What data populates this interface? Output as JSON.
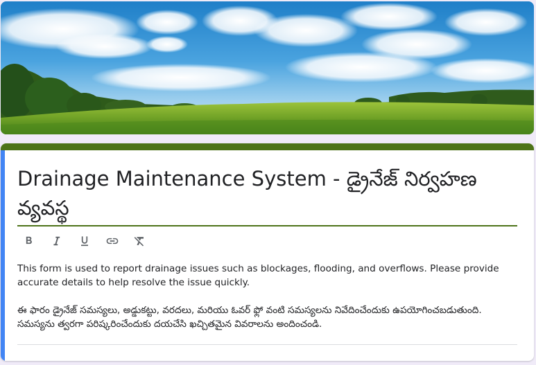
{
  "form": {
    "title": "Drainage Maintenance System - డ్రైనేజ్ నిర్వహణ వ్యవస్థ",
    "description_en": " This form is used to report drainage issues such as blockages, flooding, and overflows. Please provide accurate details to help resolve the issue quickly.",
    "description_te": "ఈ ఫారం డ్రైనేజ్ సమస్యలు, అడ్డుకట్టు, వరదలు, మరియు ఓవర్ ఫ్లో వంటి సమస్యలను నివేదించేందుకు ఉపయోగించబడుతుంది. సమస్యను త్వరగా పరిష్కరించేందుకు దయచేసి ఖచ్చితమైన వివరాలను అందించండి."
  },
  "toolbar": {
    "icons": [
      "bold-icon",
      "italic-icon",
      "underline-icon",
      "link-icon",
      "clear-formatting-icon"
    ]
  },
  "colors": {
    "theme_green": "#4d7318",
    "focus_blue": "#4285f4",
    "background": "#f0ebf8"
  }
}
